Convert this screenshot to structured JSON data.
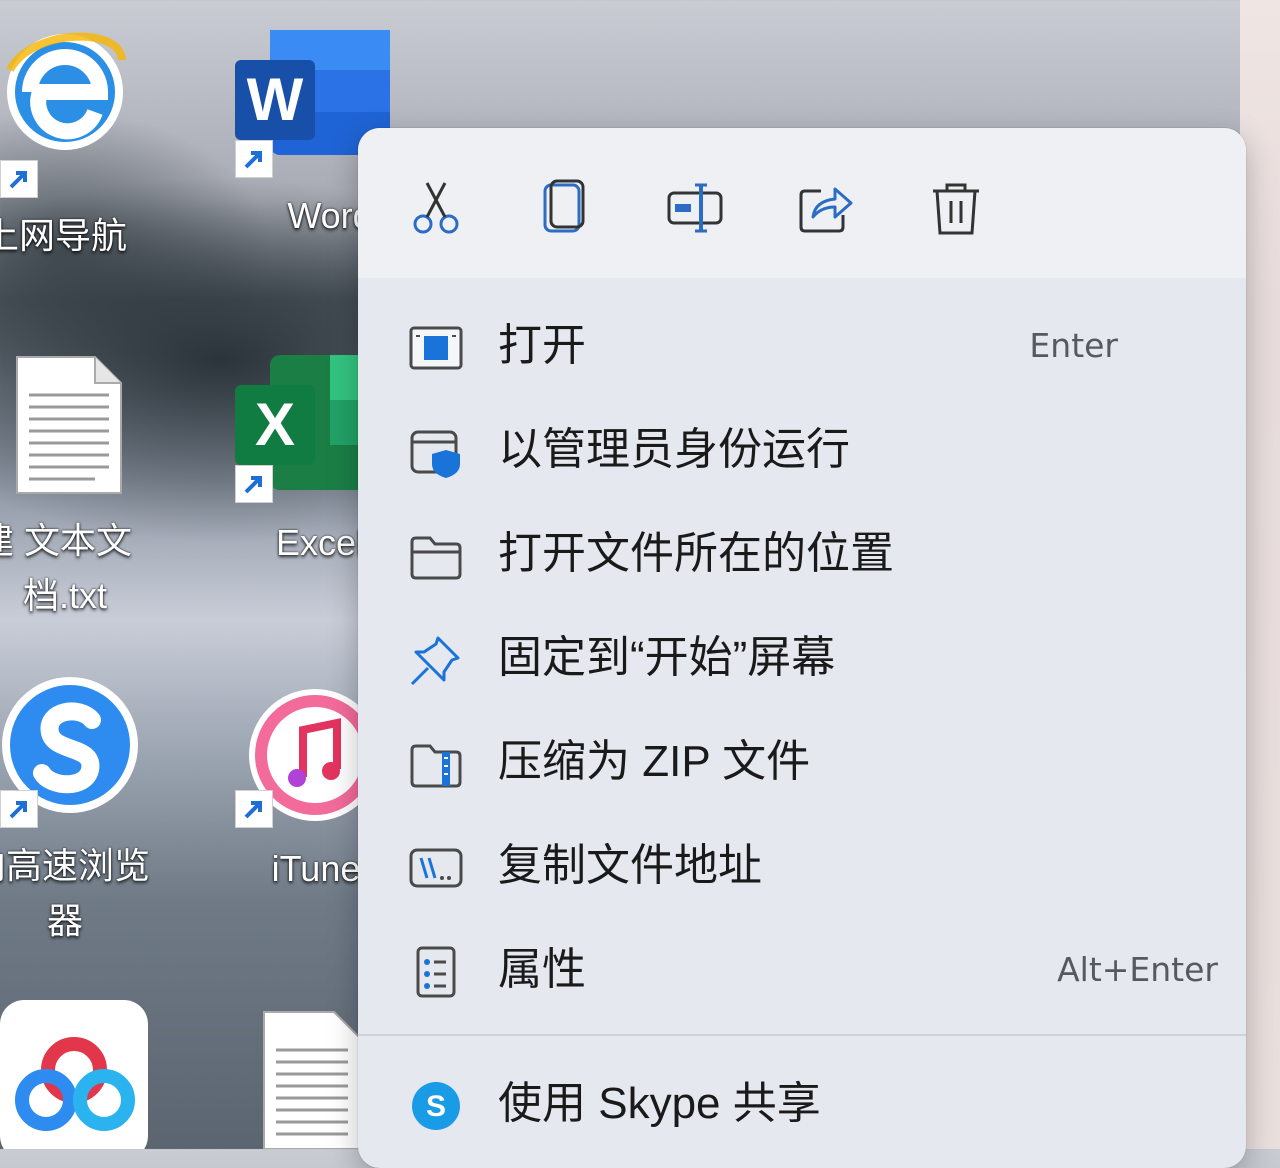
{
  "desktop": {
    "icons": [
      {
        "label": "上网导航",
        "icon": "ie-browser-icon"
      },
      {
        "label": "Word",
        "icon": "word-icon"
      },
      {
        "label": "建 文本文",
        "label2": "档.txt",
        "icon": "text-file-icon"
      },
      {
        "label": "Excel",
        "icon": "excel-icon"
      },
      {
        "label": "向高速浏览",
        "label2": "器",
        "icon": "sogou-browser-icon"
      },
      {
        "label": "iTunes",
        "icon": "itunes-icon"
      },
      {
        "label": "",
        "icon": "baidu-netdisk-icon"
      },
      {
        "label": "",
        "icon": "document-icon"
      }
    ]
  },
  "context_menu": {
    "toolbar": [
      {
        "name": "cut",
        "icon": "scissors-icon"
      },
      {
        "name": "copy",
        "icon": "copy-icon"
      },
      {
        "name": "rename",
        "icon": "rename-icon"
      },
      {
        "name": "share",
        "icon": "share-icon"
      },
      {
        "name": "delete",
        "icon": "trash-icon"
      }
    ],
    "items": [
      {
        "label": "打开",
        "shortcut": "Enter",
        "icon": "open-window-icon"
      },
      {
        "label": "以管理员身份运行",
        "shortcut": "",
        "icon": "admin-shield-icon"
      },
      {
        "label": "打开文件所在的位置",
        "shortcut": "",
        "icon": "folder-icon"
      },
      {
        "label": "固定到“开始”屏幕",
        "shortcut": "",
        "icon": "pin-icon"
      },
      {
        "label": "压缩为 ZIP 文件",
        "shortcut": "",
        "icon": "zip-folder-icon"
      },
      {
        "label": "复制文件地址",
        "shortcut": "",
        "icon": "copy-path-icon"
      },
      {
        "label": "属性",
        "shortcut": "Alt+Enter",
        "icon": "properties-icon"
      },
      {
        "label": "使用 Skype 共享",
        "shortcut": "",
        "icon": "skype-icon"
      }
    ]
  },
  "colors": {
    "accent": "#1a73d9",
    "menu_bg": "#e5e8ee",
    "icon_stroke": "#2b5fa8"
  }
}
